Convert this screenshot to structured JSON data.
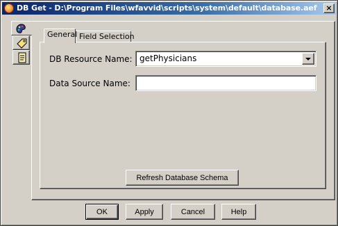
{
  "window": {
    "title": "DB Get - D:\\Program Files\\wfavvid\\scripts\\system\\default\\database.aef",
    "close_label": "×"
  },
  "side_tabs": [
    {
      "icon": "palette-icon"
    },
    {
      "icon": "tag-icon"
    },
    {
      "icon": "document-icon"
    }
  ],
  "tabs": {
    "general": "General",
    "field_selection": "Field Selection"
  },
  "form": {
    "db_resource_label": "DB Resource Name:",
    "db_resource_value": "getPhysicians",
    "data_source_label": "Data Source Name:",
    "data_source_value": ""
  },
  "refresh_button": "Refresh Database Schema",
  "footer": {
    "ok": "OK",
    "apply": "Apply",
    "cancel": "Cancel",
    "help": "Help"
  }
}
